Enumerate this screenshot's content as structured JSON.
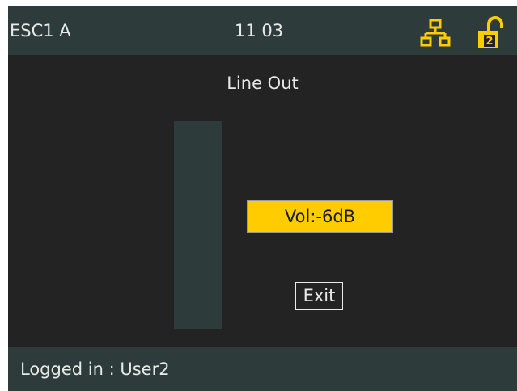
{
  "header": {
    "device_name": "ESC1 A",
    "time": "11 03",
    "network_icon": "network-icon",
    "lock_icon": "unlocked-user-2-icon",
    "lock_badge": "2",
    "accent_color": "#ffcc00"
  },
  "main": {
    "title": "Line Out",
    "level_fraction": 0,
    "volume_label": "Vol:-6dB",
    "exit_label": "Exit"
  },
  "footer": {
    "status": "Logged in : User2"
  }
}
